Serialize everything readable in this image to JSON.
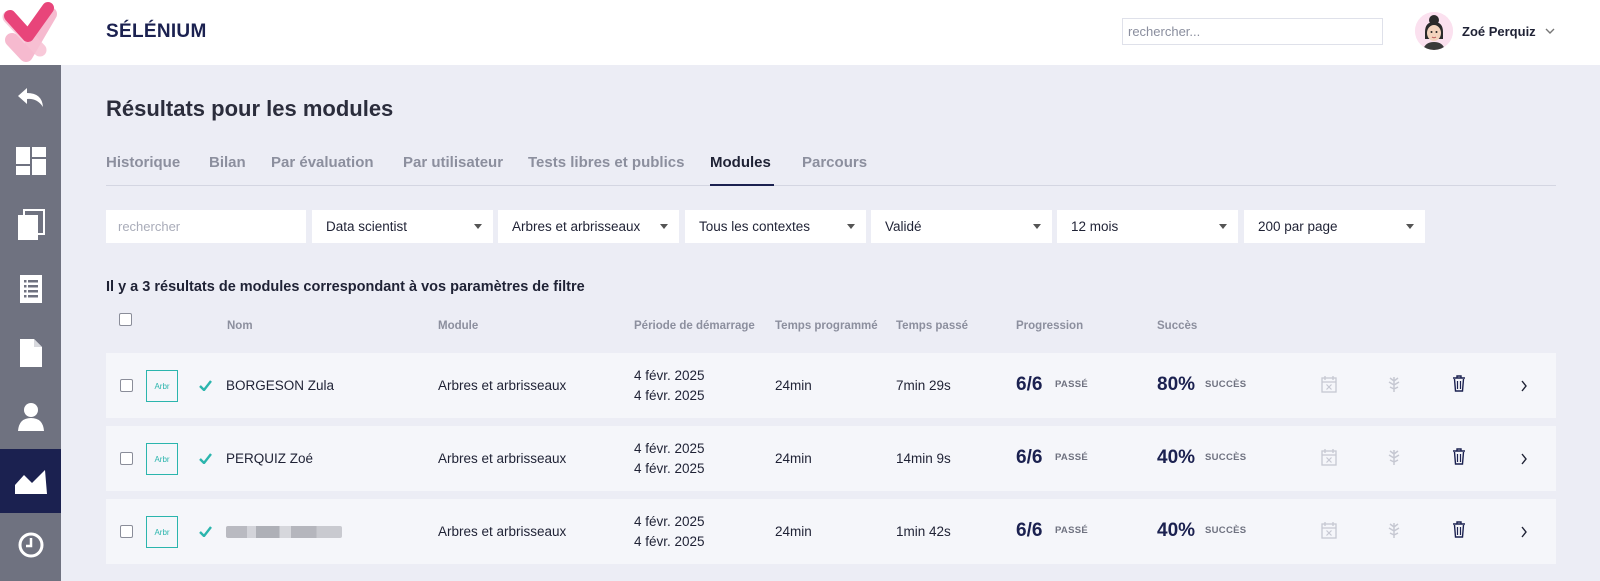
{
  "header": {
    "app_name": "SÉLÉNIUM",
    "search_placeholder": "rechercher...",
    "user_name": "Zoé Perquiz"
  },
  "page": {
    "title": "Résultats pour les modules"
  },
  "tabs": [
    {
      "label": "Historique",
      "active": false
    },
    {
      "label": "Bilan",
      "active": false
    },
    {
      "label": "Par évaluation",
      "active": false
    },
    {
      "label": "Par utilisateur",
      "active": false
    },
    {
      "label": "Tests libres et publics",
      "active": false
    },
    {
      "label": "Modules",
      "active": true
    },
    {
      "label": "Parcours",
      "active": false
    }
  ],
  "filters": {
    "search_placeholder": "rechercher",
    "selects": [
      "Data scientist",
      "Arbres et arbrisseaux",
      "Tous les contextes",
      "Validé",
      "12 mois",
      "200 par page"
    ]
  },
  "result_count": "Il y a 3 résultats de modules correspondant à vos paramètres de filtre",
  "table": {
    "headers": {
      "name": "Nom",
      "module": "Module",
      "period": "Période de démarrage",
      "planned": "Temps programmé",
      "spent": "Temps passé",
      "progress": "Progression",
      "success": "Succès"
    },
    "rows": [
      {
        "thumb": "Arbr",
        "name": "BORGESON Zula",
        "module": "Arbres et arbrisseaux",
        "start": "4 févr. 2025",
        "end": "4 févr. 2025",
        "planned": "24min",
        "spent": "7min 29s",
        "progress": "6/6",
        "progress_tag": "PASSÉ",
        "success": "80%",
        "success_tag": "SUCCÈS"
      },
      {
        "thumb": "Arbr",
        "name": "PERQUIZ Zoé",
        "module": "Arbres et arbrisseaux",
        "start": "4 févr. 2025",
        "end": "4 févr. 2025",
        "planned": "24min",
        "spent": "14min 9s",
        "progress": "6/6",
        "progress_tag": "PASSÉ",
        "success": "40%",
        "success_tag": "SUCCÈS"
      },
      {
        "thumb": "Arbr",
        "name": "",
        "module": "Arbres et arbrisseaux",
        "start": "4 févr. 2025",
        "end": "4 févr. 2025",
        "planned": "24min",
        "spent": "1min 42s",
        "progress": "6/6",
        "progress_tag": "PASSÉ",
        "success": "40%",
        "success_tag": "SUCCÈS"
      }
    ]
  },
  "colors": {
    "brand_navy": "#1b2150",
    "sidebar_gray": "#6f7280",
    "accent_teal": "#2bb5ad",
    "logo_pink": "#e8457a"
  },
  "icons": {
    "sidebar": [
      "back-arrow-icon",
      "dashboard-icon",
      "pages-icon",
      "list-icon",
      "document-icon",
      "user-icon",
      "chart-icon",
      "clock-icon"
    ],
    "row_actions": [
      "calendar-x-icon",
      "leaf-icon",
      "trash-icon",
      "chevron-right-icon"
    ]
  }
}
